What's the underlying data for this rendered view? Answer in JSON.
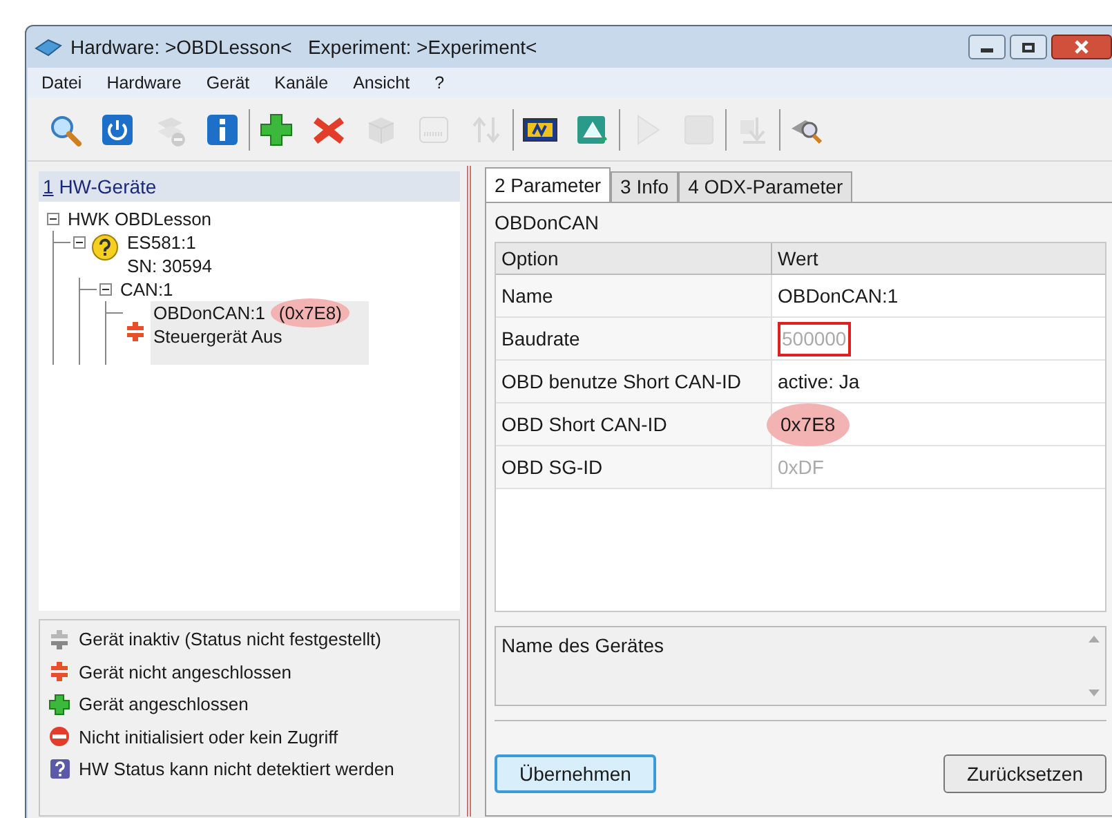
{
  "window": {
    "title": "Hardware: >OBDLesson<   Experiment: >Experiment<"
  },
  "menu": [
    "Datei",
    "Hardware",
    "Gerät",
    "Kanäle",
    "Ansicht",
    "?"
  ],
  "toolbar": [
    [
      {
        "disabled": false
      },
      {
        "disabled": false
      },
      {
        "disabled": true
      },
      {
        "disabled": false
      }
    ],
    [
      {
        "disabled": false
      },
      {
        "disabled": false
      },
      {
        "disabled": true
      },
      {
        "disabled": true
      },
      {
        "disabled": true
      }
    ],
    [
      {
        "disabled": false
      },
      {
        "disabled": false
      }
    ],
    [
      {
        "disabled": true
      },
      {
        "disabled": true
      }
    ],
    [
      {
        "disabled": true
      }
    ],
    [
      {
        "disabled": false
      }
    ]
  ],
  "left_panel": {
    "mnemonic": "1",
    "title": "HW-Geräte",
    "tree": [
      {
        "label": "HWK OBDLesson",
        "expanded": true,
        "children": [
          {
            "label": "ES581:1",
            "sublabel": "SN: 30594",
            "kind": "unknown",
            "expanded": true,
            "children": [
              {
                "label": "CAN:1",
                "expanded": true,
                "children": [
                  {
                    "label": "OBDonCAN:1",
                    "id": "(0x7E8)",
                    "id_highlighted": true,
                    "sublabel": "Steuergerät Aus",
                    "kind": "disconnected",
                    "selected": true
                  }
                ]
              }
            ]
          }
        ]
      }
    ],
    "legend": [
      {
        "kind": "inactive",
        "text": "Gerät inaktiv (Status nicht festgestellt)"
      },
      {
        "kind": "disconnected",
        "text": "Gerät nicht angeschlossen"
      },
      {
        "kind": "connected",
        "text": "Gerät angeschlossen"
      },
      {
        "kind": "error",
        "text": "Nicht initialisiert oder kein Zugriff"
      },
      {
        "kind": "unknown",
        "text": "HW Status kann nicht detektiert werden"
      }
    ]
  },
  "tabs": [
    {
      "label": "2 Parameter",
      "selected": true
    },
    {
      "label": "3 Info",
      "selected": false
    },
    {
      "label": "4 ODX-Parameter",
      "selected": false
    }
  ],
  "group_title": "OBDonCAN",
  "table": {
    "columns": [
      "Option",
      "Wert"
    ],
    "rows": [
      {
        "option": "Name",
        "value": "OBDonCAN:1",
        "disabled": false
      },
      {
        "option": "Baudrate",
        "value": "500000",
        "disabled": true,
        "outlined": true
      },
      {
        "option": "OBD benutze Short CAN-ID",
        "value": "active: Ja",
        "disabled": false
      },
      {
        "option": "OBD Short CAN-ID",
        "value": "0x7E8",
        "disabled": false,
        "circled": true
      },
      {
        "option": "OBD SG-ID",
        "value": "0xDF",
        "disabled": true
      }
    ]
  },
  "description": "Name des Gerätes",
  "buttons": [
    {
      "label": "Übernehmen",
      "default": true
    },
    {
      "label": "Zurücksetzen",
      "default": false
    }
  ]
}
